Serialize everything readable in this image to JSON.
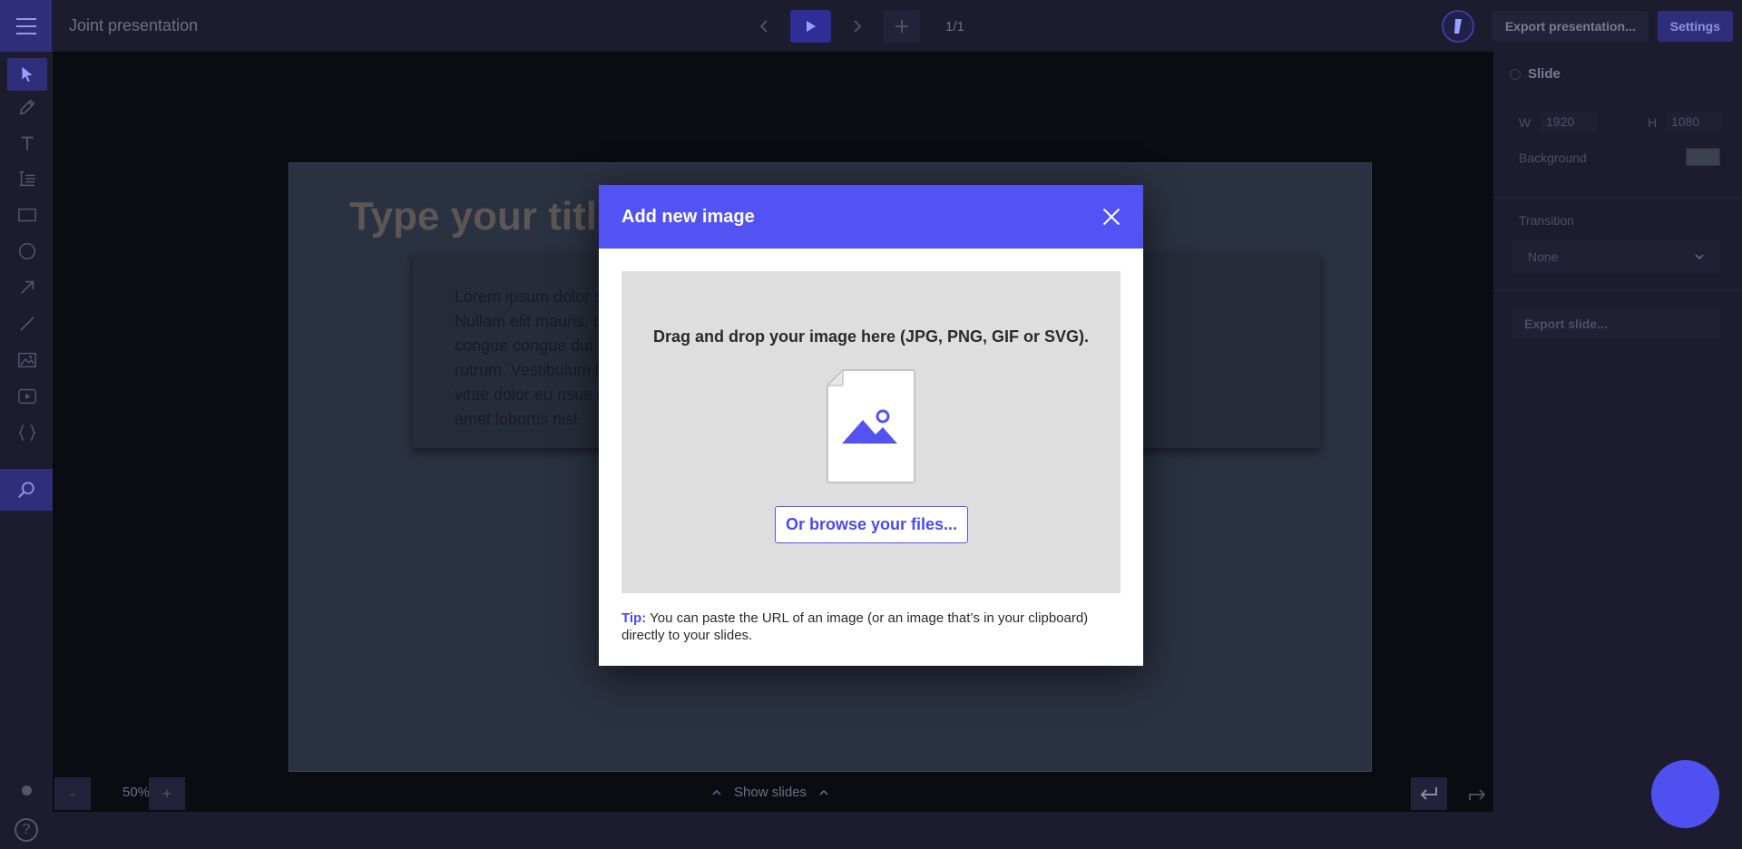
{
  "header": {
    "doc_title": "Joint presentation",
    "page_counter": "1/1",
    "export_presentation": "Export presentation...",
    "settings": "Settings"
  },
  "toolbar": {
    "tools": [
      "select-tool",
      "pen-tool",
      "text-tool",
      "list-tool",
      "rectangle-tool",
      "circle-tool",
      "arrow-tool",
      "line-tool",
      "image-tool",
      "video-tool",
      "code-tool",
      "search-tool"
    ]
  },
  "slide": {
    "title_placeholder": "Type your title here...",
    "body_lines": [
      "Lorem ipsum dolor sit amet, c",
      "Nullam elit mauris, tristique vit",
      "congue congue dui. Integer ali",
      "rutrum. Vestibulum luctus cong",
      "vitae dolor eu risus ullamcorpe",
      "amet lobortis nisi."
    ]
  },
  "panel": {
    "heading": "Slide",
    "width_label": "W",
    "width_value": "1920",
    "height_label": "H",
    "height_value": "1080",
    "background_label": "Background",
    "background_color": "#3a4250",
    "transition_label": "Transition",
    "transition_value": "None",
    "export_slide": "Export slide..."
  },
  "bottom": {
    "zoom_minus": "-",
    "zoom_value": "50%",
    "zoom_plus": "+",
    "show_slides": "Show slides",
    "help": "?"
  },
  "modal": {
    "title": "Add new image",
    "drop_text": "Drag and drop your image here (JPG, PNG, GIF or SVG).",
    "browse_button": "Or browse your files...",
    "tip_label": "Tip:",
    "tip_text": " You can paste the URL of an image (or an image that’s in your clipboard) directly to your slides."
  },
  "colors": {
    "accent": "#5353f3",
    "fab": "#4f50f0"
  }
}
